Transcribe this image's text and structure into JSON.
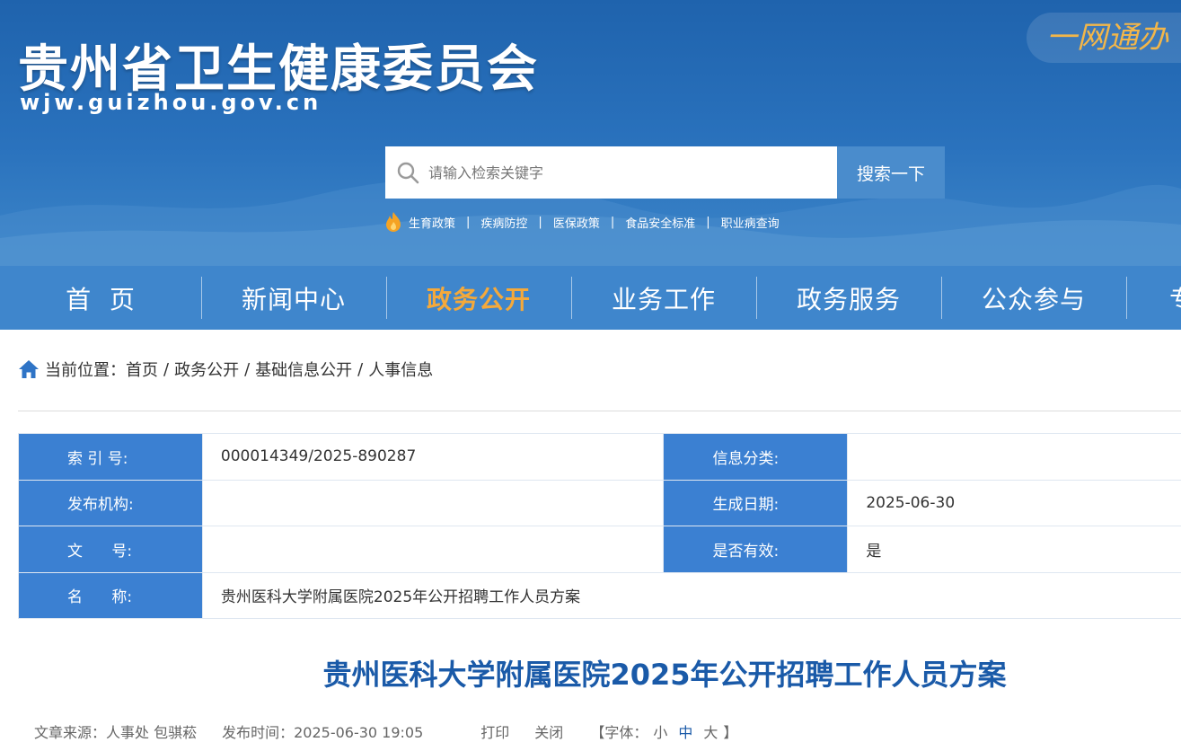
{
  "header": {
    "site_title": "贵州省卫生健康委员会",
    "site_domain": "wjw.guizhou.gov.cn",
    "slogan": "一网通办",
    "search": {
      "placeholder": "请输入检索关键字",
      "button_label": "搜索一下"
    },
    "hotlinks": [
      "生育政策",
      "疾病防控",
      "医保政策",
      "食品安全标准",
      "职业病查询"
    ],
    "hotlink_separator": "|"
  },
  "nav": {
    "items": [
      "首  页",
      "新闻中心",
      "政务公开",
      "业务工作",
      "政务服务",
      "公众参与",
      "专"
    ],
    "active_index": 2
  },
  "breadcrumb": {
    "prefix": "当前位置：",
    "items": [
      "首页",
      "政务公开",
      "基础信息公开",
      "人事信息"
    ],
    "separator": "/"
  },
  "info_table": {
    "index_no_label": "索 引 号:",
    "index_no": "000014349/2025-890287",
    "category_label": "信息分类:",
    "category": "",
    "publisher_label": "发布机构:",
    "publisher": "",
    "created_label": "生成日期:",
    "created": "2025-06-30",
    "doc_no_label": "文      号:",
    "doc_no": "",
    "valid_label": "是否有效:",
    "valid": "是",
    "name_label": "名      称:",
    "name": "贵州医科大学附属医院2025年公开招聘工作人员方案"
  },
  "article": {
    "title": "贵州医科大学附属医院2025年公开招聘工作人员方案",
    "source": "文章来源：人事处 包骐菘",
    "publish_time": "发布时间：2025-06-30 19:05",
    "print_label": "打印",
    "close_label": "关闭",
    "font_prefix": "【字体：",
    "font_small": "小",
    "font_medium": "中",
    "font_large": "大",
    "font_suffix": "】"
  },
  "colors": {
    "banner_blue": "#1f63ad",
    "nav_blue": "#3f86cc",
    "nav_active": "#f5a93a",
    "label_blue": "#3b80d2",
    "title_blue": "#1a5aa8"
  }
}
